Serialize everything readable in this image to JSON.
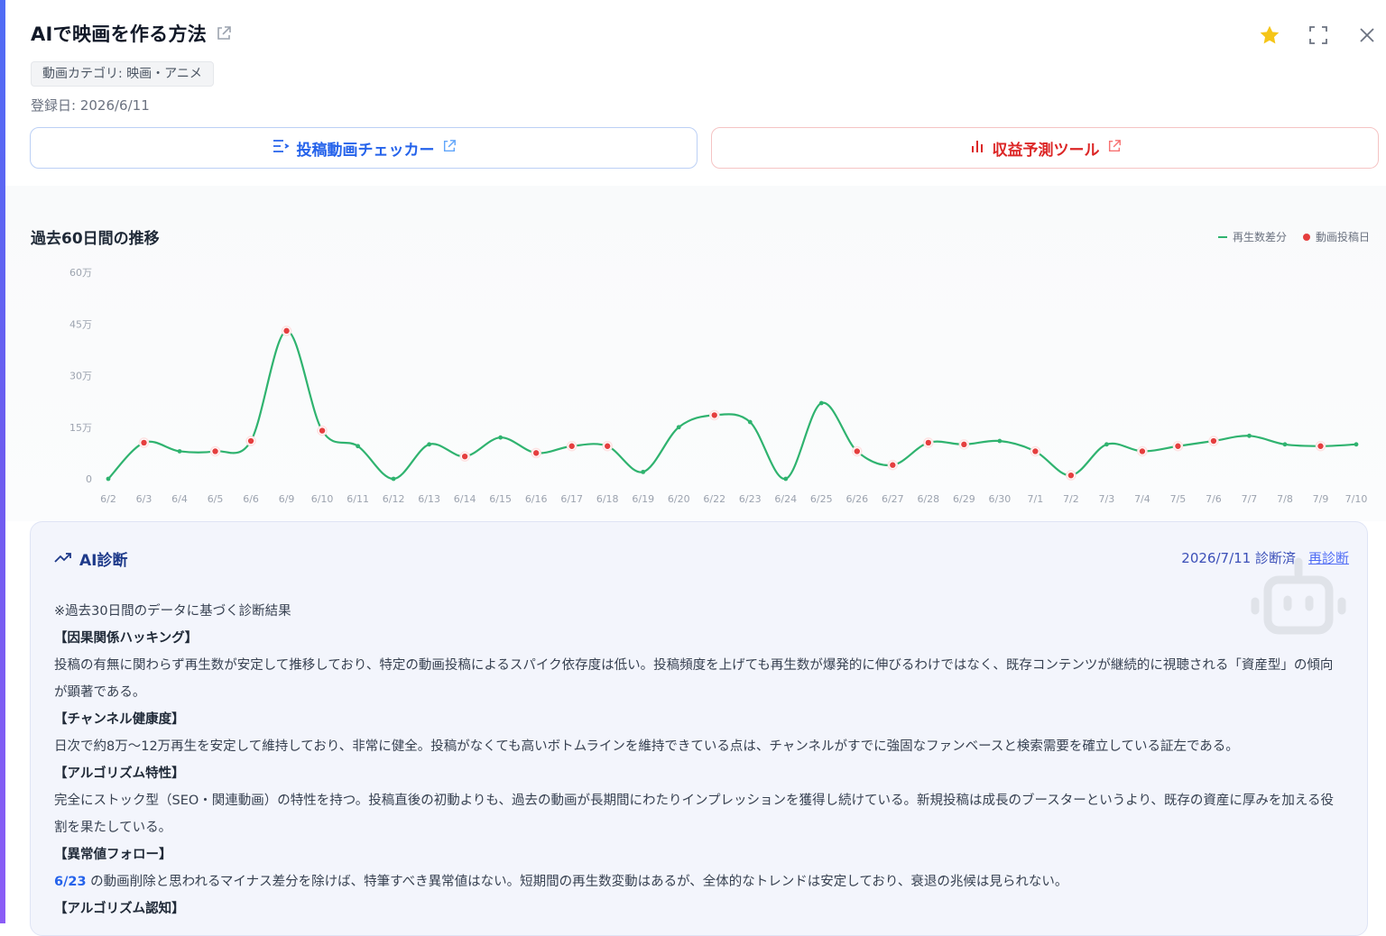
{
  "header": {
    "title": "AIで映画を作る方法",
    "category": "動画カテゴリ: 映画・アニメ",
    "registered": "登録日: 2026/6/11"
  },
  "buttons": {
    "checker_label": "投稿動画チェッカー",
    "revenue_label": "収益予測ツール"
  },
  "icons": {
    "star": "star-icon",
    "expand": "expand-icon",
    "close": "close-icon",
    "external": "external-link-icon",
    "list": "list-icon",
    "bar_chart": "bar-chart-icon",
    "trend": "trend-icon",
    "robot": "robot-icon"
  },
  "colors": {
    "star": "#f5c518",
    "line": "#2fb36f",
    "post_dot": "#e53e3e",
    "blue": "#2563eb",
    "red": "#dc2626"
  },
  "chart_section": {
    "title": "過去60日間の推移"
  },
  "chart_data": {
    "type": "line",
    "x": [
      "6/2",
      "6/3",
      "6/4",
      "6/5",
      "6/6",
      "6/9",
      "6/10",
      "6/11",
      "6/12",
      "6/13",
      "6/14",
      "6/15",
      "6/16",
      "6/17",
      "6/18",
      "6/19",
      "6/20",
      "6/22",
      "6/23",
      "6/24",
      "6/25",
      "6/26",
      "6/27",
      "6/28",
      "6/29",
      "6/30",
      "7/1",
      "7/2",
      "7/3",
      "7/4",
      "7/5",
      "7/6",
      "7/7",
      "7/8",
      "7/9",
      "7/10"
    ],
    "series": [
      {
        "name": "再生数差分",
        "values": [
          0,
          10.5,
          8,
          8,
          11,
          43,
          14,
          9.5,
          0,
          10,
          6.5,
          12,
          7.5,
          9.5,
          9.5,
          2,
          15,
          18.5,
          16.5,
          0,
          22,
          8,
          4,
          10.5,
          10,
          11,
          8,
          1,
          10,
          8,
          9.5,
          11,
          12.5,
          10,
          9.5,
          10
        ]
      }
    ],
    "post_markers": {
      "name": "動画投稿日",
      "x": [
        "6/3",
        "6/5",
        "6/6",
        "6/9",
        "6/10",
        "6/14",
        "6/16",
        "6/17",
        "6/18",
        "6/22",
        "6/26",
        "6/27",
        "6/28",
        "6/29",
        "7/1",
        "7/2",
        "7/4",
        "7/5",
        "7/6",
        "7/9"
      ]
    },
    "yticks": [
      "0",
      "15万",
      "30万",
      "45万",
      "60万"
    ],
    "ylim": [
      0,
      60
    ],
    "grid": false,
    "legend": "top-right"
  },
  "ai": {
    "title": "AI診断",
    "date": "2026/7/11 診断済",
    "rediagnose": "再診断",
    "intro": "※過去30日間のデータに基づく診断結果",
    "h1": "【因果関係ハッキング】",
    "p1": "投稿の有無に関わらず再生数が安定して推移しており、特定の動画投稿によるスパイク依存度は低い。投稿頻度を上げても再生数が爆発的に伸びるわけではなく、既存コンテンツが継続的に視聴される「資産型」の傾向が顕著である。",
    "h2": "【チャンネル健康度】",
    "p2": "日次で約8万〜12万再生を安定して維持しており、非常に健全。投稿がなくても高いボトムラインを維持できている点は、チャンネルがすでに強固なファンベースと検索需要を確立している証左である。",
    "h3": "【アルゴリズム特性】",
    "p3": "完全にストック型（SEO・関連動画）の特性を持つ。投稿直後の初動よりも、過去の動画が長期間にわたりインプレッションを獲得し続けている。新規投稿は成長のブースターというより、既存の資産に厚みを加える役割を果たしている。",
    "h4": "【異常値フォロー】",
    "p4_highlight": "6/23",
    "p4": " の動画削除と思われるマイナス差分を除けば、特筆すべき異常値はない。短期間の再生数変動はあるが、全体的なトレンドは安定しており、衰退の兆候は見られない。",
    "h5": "【アルゴリズム認知】"
  }
}
